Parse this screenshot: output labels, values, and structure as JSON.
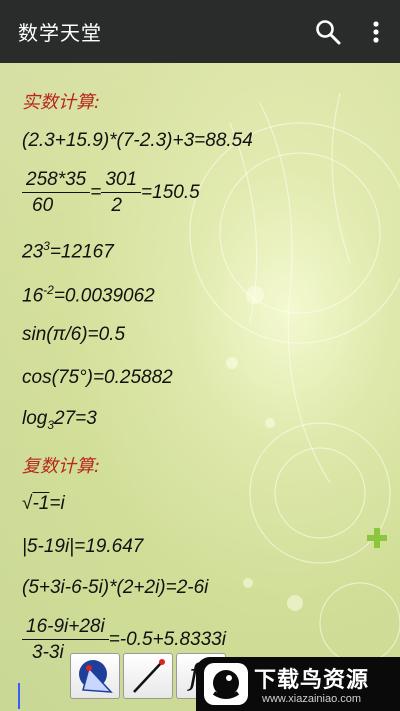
{
  "app": {
    "title": "数学天堂",
    "actions": {
      "search_icon": "search-icon",
      "more_icon": "more-vert-icon"
    }
  },
  "real_section": {
    "heading": "实数计算:",
    "expr1": "(2.3+15.9)*(7-2.3)+3=88.54",
    "frac1": {
      "num1": "258*35",
      "den1": "60",
      "eq": "=",
      "num2": "301",
      "den2": "2",
      "result": "=150.5"
    },
    "power": {
      "base": "23",
      "exp": "3",
      "result": "=12167"
    },
    "neg_power": {
      "base": "16",
      "exp": "-2",
      "result": "=0.0039062"
    },
    "sin": "sin(π/6)=0.5",
    "cos": "cos(75°)=0.25882",
    "log": {
      "prefix": "log",
      "base": "3",
      "rest": "27=3"
    }
  },
  "complex_section": {
    "heading": "复数计算:",
    "sqrt": {
      "symbol": "√",
      "radicand": "-1",
      "result": "=i"
    },
    "abs": "|5-19i|=19.647",
    "product": "(5+3i-6-5i)*(2+2i)=2-6i",
    "frac": {
      "num": "16-9i+28i",
      "den": "3-3i",
      "result": "=-0.5+5.8333i"
    }
  },
  "toolbar": {
    "fx_label": "f"
  },
  "watermark": {
    "brand": "下载鸟资源",
    "url": "www.xiazainiao.com"
  },
  "colors": {
    "appbar": "#2a2c2b",
    "heading": "#b8281e",
    "plus": "#8cc63f"
  }
}
